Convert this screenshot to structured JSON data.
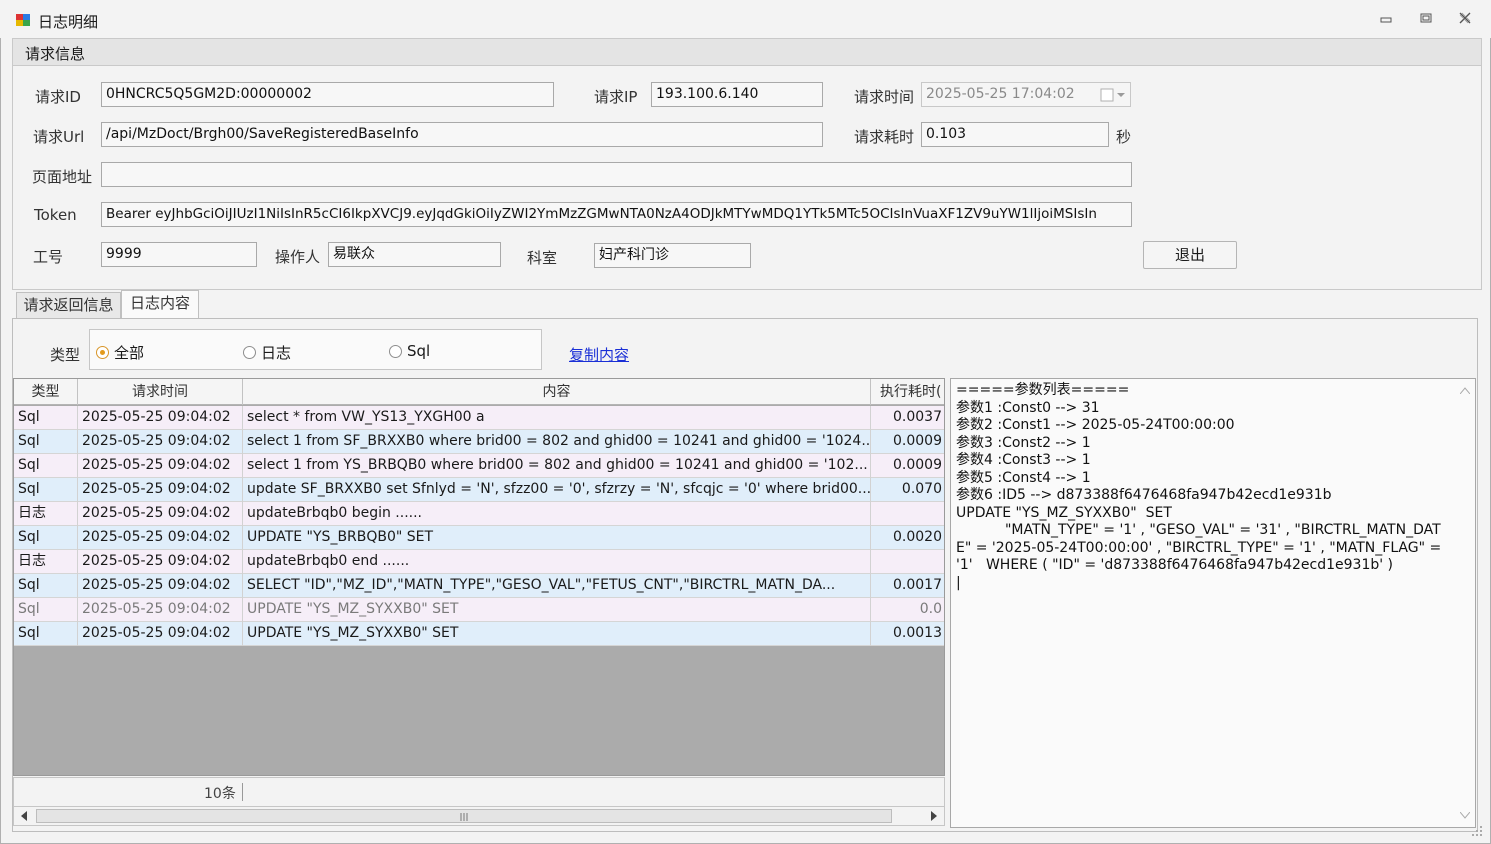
{
  "window": {
    "title": "日志明细",
    "minimize": "▭",
    "maximize": "▢",
    "close": "✕"
  },
  "request_group": {
    "header": "请求信息",
    "fields": {
      "request_id_label": "请求ID",
      "request_id": "0HNCRC5Q5GM2D:00000002",
      "request_ip_label": "请求IP",
      "request_ip": "193.100.6.140",
      "request_time_label": "请求时间",
      "request_time": "2025-05-25 17:04:02",
      "request_url_label": "请求Url",
      "request_url": "/api/MzDoct/Brgh00/SaveRegisteredBaseInfo",
      "elapsed_label": "请求耗时",
      "elapsed": "0.103",
      "elapsed_unit": "秒",
      "page_label": "页面地址",
      "page": "",
      "token_label": "Token",
      "token": "Bearer eyJhbGciOiJIUzI1NiIsInR5cCI6IkpXVCJ9.eyJqdGkiOiIyZWI2YmMzZGMwNTA0NzA4ODJkMTYwMDQ1YTk5MTc5OCIsInVuaXF1ZV9uYW1lIjoiMSIsIn",
      "emp_no_label": "工号",
      "emp_no": "9999",
      "operator_label": "操作人",
      "operator": "易联众",
      "dept_label": "科室",
      "dept": "妇产科门诊",
      "exit_button": "退出"
    }
  },
  "tabs": [
    {
      "label": "请求返回信息",
      "active": false
    },
    {
      "label": "日志内容",
      "active": true
    }
  ],
  "filter": {
    "type_label": "类型",
    "options": [
      {
        "label": "全部",
        "checked": true
      },
      {
        "label": "日志",
        "checked": false
      },
      {
        "label": "Sql",
        "checked": false
      }
    ],
    "copy_link": "复制内容"
  },
  "grid": {
    "columns": [
      "类型",
      "请求时间",
      "内容",
      "执行耗时("
    ],
    "rows": [
      {
        "type": "Sql",
        "time": "2025-05-25 09:04:02",
        "content": "select * from VW_YS13_YXGH00 a",
        "cost": "0.0037"
      },
      {
        "type": "Sql",
        "time": "2025-05-25 09:04:02",
        "content": "select 1 from SF_BRXXB0 where brid00 = 802 and ghid00 = 10241 and ghid00 = '1024...",
        "cost": "0.0009"
      },
      {
        "type": "Sql",
        "time": "2025-05-25 09:04:02",
        "content": "select 1 from YS_BRBQB0 where brid00 = 802 and ghid00 = 10241 and ghid00 = '102...",
        "cost": "0.0009"
      },
      {
        "type": "Sql",
        "time": "2025-05-25 09:04:02",
        "content": "update SF_BRXXB0 set  Sfnlyd = 'N', sfzz00 = '0', sfzrzy = 'N', sfcqjc = '0' where brid00...",
        "cost": "0.070"
      },
      {
        "type": "日志",
        "time": "2025-05-25 09:04:02",
        "content": " updateBrbqb0 begin ......",
        "cost": ""
      },
      {
        "type": "Sql",
        "time": "2025-05-25 09:04:02",
        "content": "UPDATE \"YS_BRBQB0\"  SET",
        "cost": "0.0020"
      },
      {
        "type": "日志",
        "time": "2025-05-25 09:04:02",
        "content": " updateBrbqb0 end ......",
        "cost": ""
      },
      {
        "type": "Sql",
        "time": "2025-05-25 09:04:02",
        "content": " SELECT \"ID\",\"MZ_ID\",\"MATN_TYPE\",\"GESO_VAL\",\"FETUS_CNT\",\"BIRCTRL_MATN_DA...",
        "cost": "0.0017"
      },
      {
        "type": "Sql",
        "time": "2025-05-25 09:04:02",
        "content": "UPDATE \"YS_MZ_SYXXB0\"  SET",
        "cost": "0.0"
      },
      {
        "type": "Sql",
        "time": "2025-05-25 09:04:02",
        "content": "UPDATE \"YS_MZ_SYXXB0\"  SET",
        "cost": "0.0013"
      }
    ],
    "footer_count": "10条"
  },
  "detail": {
    "text": "=====参数列表=====\n参数1 :Const0 --> 31\n参数2 :Const1 --> 2025-05-24T00:00:00\n参数3 :Const2 --> 1\n参数4 :Const3 --> 1\n参数5 :Const4 --> 1\n参数6 :ID5 --> d873388f6476468fa947b42ecd1e931b\nUPDATE \"YS_MZ_SYXXB0\"  SET\n           \"MATN_TYPE\" = '1' , \"GESO_VAL\" = '31' , \"BIRCTRL_MATN_DATE\" = '2025-05-24T00:00:00' , \"BIRCTRL_TYPE\" = '1' , \"MATN_FLAG\" = '1'   WHERE ( \"ID\" = 'd873388f6476468fa947b42ecd1e931b' )\n|"
  }
}
